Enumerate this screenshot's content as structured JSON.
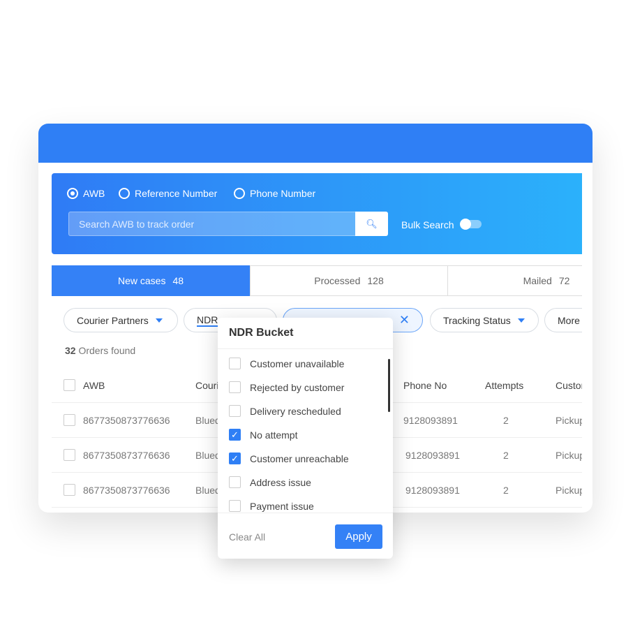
{
  "search": {
    "options": [
      {
        "label": "AWB",
        "selected": true
      },
      {
        "label": "Reference Number",
        "selected": false
      },
      {
        "label": "Phone Number",
        "selected": false
      }
    ],
    "placeholder": "Search AWB to track order",
    "bulk_label": "Bulk Search",
    "bulk_on": false
  },
  "tabs": [
    {
      "label": "New cases",
      "count": "48"
    },
    {
      "label": "Processed",
      "count": "128"
    },
    {
      "label": "Mailed",
      "count": "72"
    }
  ],
  "filters": {
    "courier": "Courier Partners",
    "ndr": "NDR",
    "tracking": "Tracking Status",
    "more": "More"
  },
  "orders": {
    "count": "32",
    "suffix": "Orders found"
  },
  "table": {
    "headers": [
      "AWB",
      "Courier",
      "Phone No",
      "Attempts",
      "Customer"
    ],
    "rows": [
      [
        "8677350873776636",
        "Bluedart",
        "9128093891",
        "2",
        "Pickup"
      ],
      [
        "8677350873776636",
        "Bluedart",
        "9128093891",
        "2",
        "Pickup"
      ],
      [
        "8677350873776636",
        "Bluedart",
        "9128093891",
        "2",
        "Pickup"
      ]
    ]
  },
  "dropdown": {
    "title": "NDR Bucket",
    "options": [
      {
        "label": "Customer unavailable",
        "checked": false
      },
      {
        "label": "Rejected by customer",
        "checked": false
      },
      {
        "label": "Delivery rescheduled",
        "checked": false
      },
      {
        "label": "No attempt",
        "checked": true
      },
      {
        "label": "Customer unreachable",
        "checked": true
      },
      {
        "label": "Address issue",
        "checked": false
      },
      {
        "label": "Payment issue",
        "checked": false
      }
    ],
    "clear_label": "Clear All",
    "apply_label": "Apply"
  },
  "colors": {
    "primary": "#2f7ff5",
    "gradient_end": "#2bb1fb"
  }
}
